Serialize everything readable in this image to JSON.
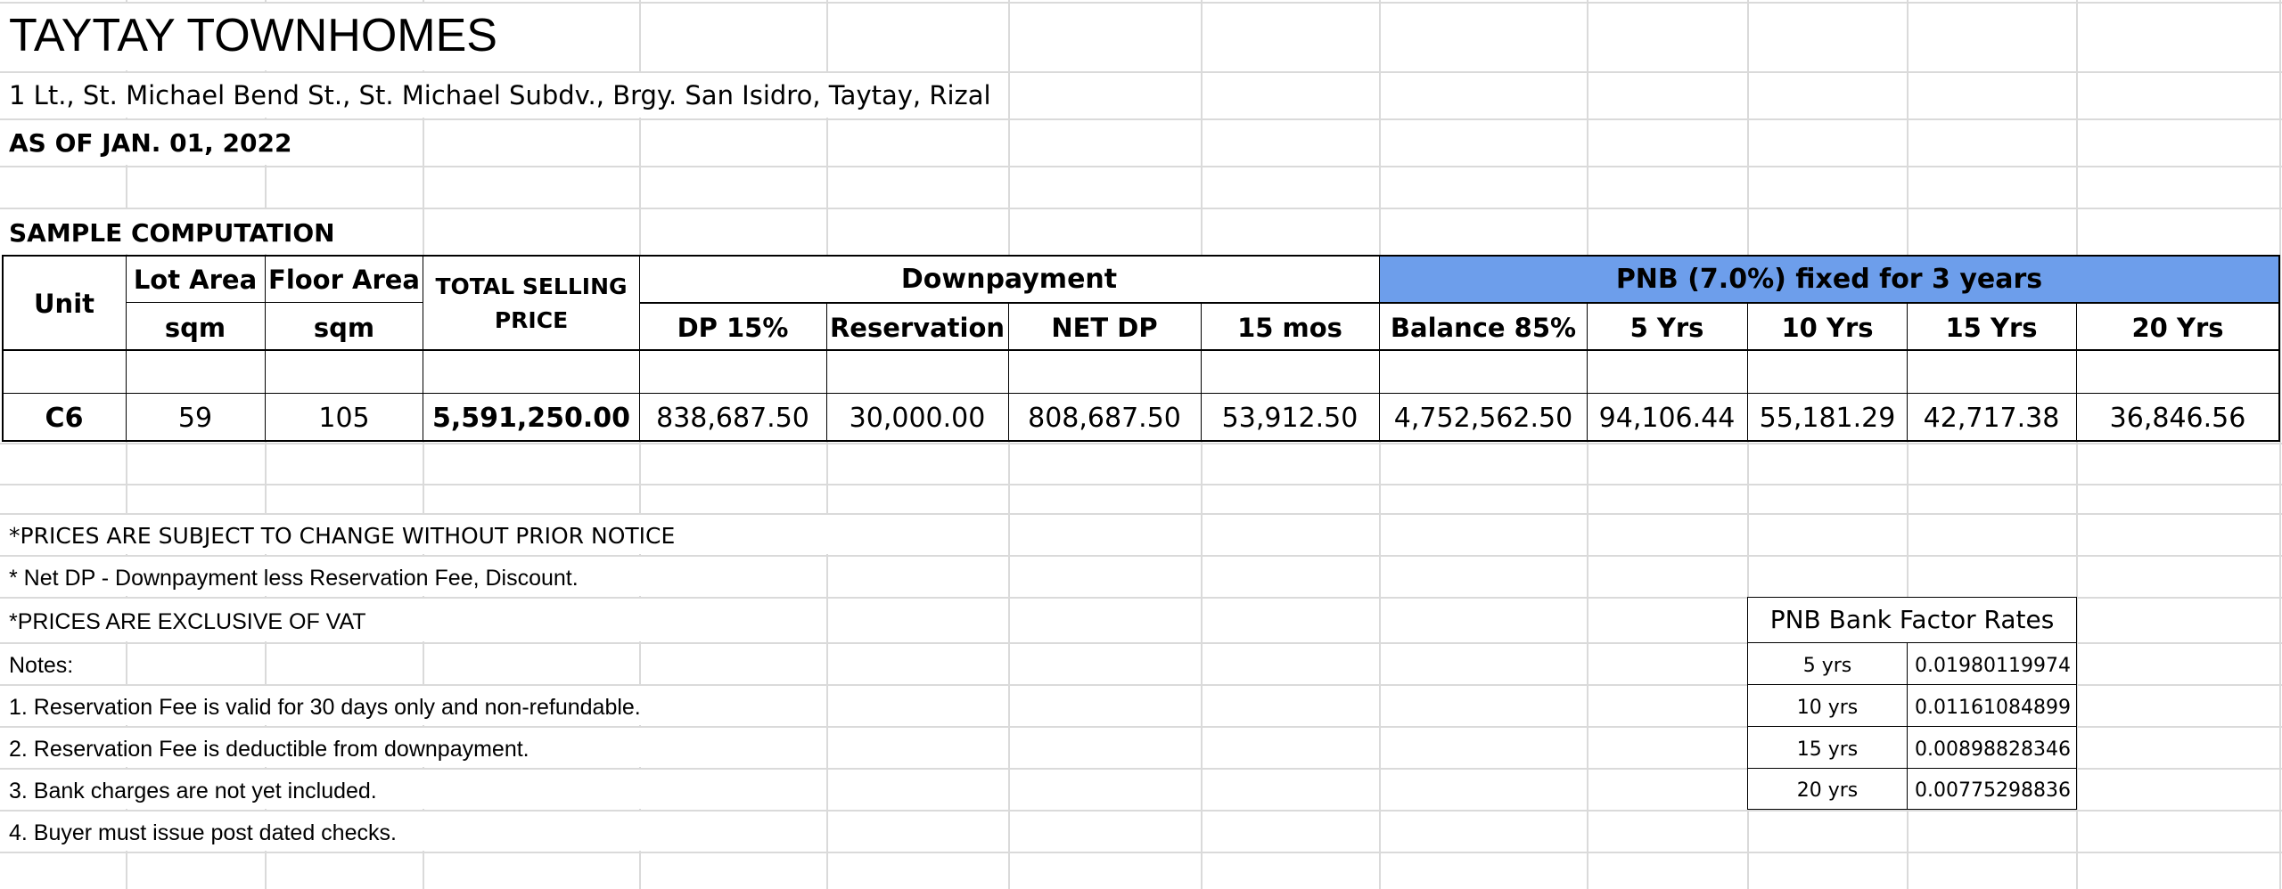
{
  "header": {
    "title": "TAYTAY TOWNHOMES",
    "address": "1 Lt., St. Michael Bend St., St. Michael Subdv., Brgy. San Isidro, Taytay, Rizal",
    "as_of": "AS OF JAN. 01, 2022",
    "section": "SAMPLE COMPUTATION"
  },
  "table": {
    "headers": {
      "unit": "Unit",
      "lot_area": "Lot Area",
      "lot_unit": "sqm",
      "floor_area": "Floor Area",
      "floor_unit": "sqm",
      "tsp_line1": "TOTAL SELLING",
      "tsp_line2": "PRICE",
      "downpayment": "Downpayment",
      "dp15": "DP 15%",
      "reservation": "Reservation",
      "netdp": "NET DP",
      "mos15": "15 mos",
      "bank": "PNB (7.0%) fixed for 3 years",
      "balance": "Balance 85%",
      "y5": "5 Yrs",
      "y10": "10 Yrs",
      "y15": "15 Yrs",
      "y20": "20 Yrs"
    },
    "row": {
      "unit": "C6",
      "lot_area": "59",
      "floor_area": "105",
      "tsp": "5,591,250.00",
      "dp15": "838,687.50",
      "reservation": "30,000.00",
      "netdp": "808,687.50",
      "mos15": "53,912.50",
      "balance": "4,752,562.50",
      "y5": "94,106.44",
      "y10": "55,181.29",
      "y15": "42,717.38",
      "y20": "36,846.56"
    }
  },
  "notes": {
    "n_prices_change": "*PRICES ARE SUBJECT TO CHANGE WITHOUT PRIOR NOTICE",
    "n_netdp": "* Net DP - Downpayment less Reservation Fee, Discount.",
    "n_vat": "*PRICES ARE EXCLUSIVE OF VAT",
    "notes_label": "Notes:",
    "items": [
      "1. Reservation Fee is valid for 30 days only and non-refundable.",
      "2. Reservation Fee is deductible from downpayment.",
      "3. Bank charges are not yet included.",
      "4. Buyer must issue post dated checks."
    ]
  },
  "factor_rates": {
    "title": "PNB Bank Factor Rates",
    "rows": [
      {
        "term": "5 yrs",
        "rate": "0.01980119974"
      },
      {
        "term": "10 yrs",
        "rate": "0.01161084899"
      },
      {
        "term": "15 yrs",
        "rate": "0.00898828346"
      },
      {
        "term": "20 yrs",
        "rate": "0.00775298836"
      }
    ]
  },
  "colors": {
    "accent_header": "#6d9eeb",
    "gridline": "#dadada"
  }
}
